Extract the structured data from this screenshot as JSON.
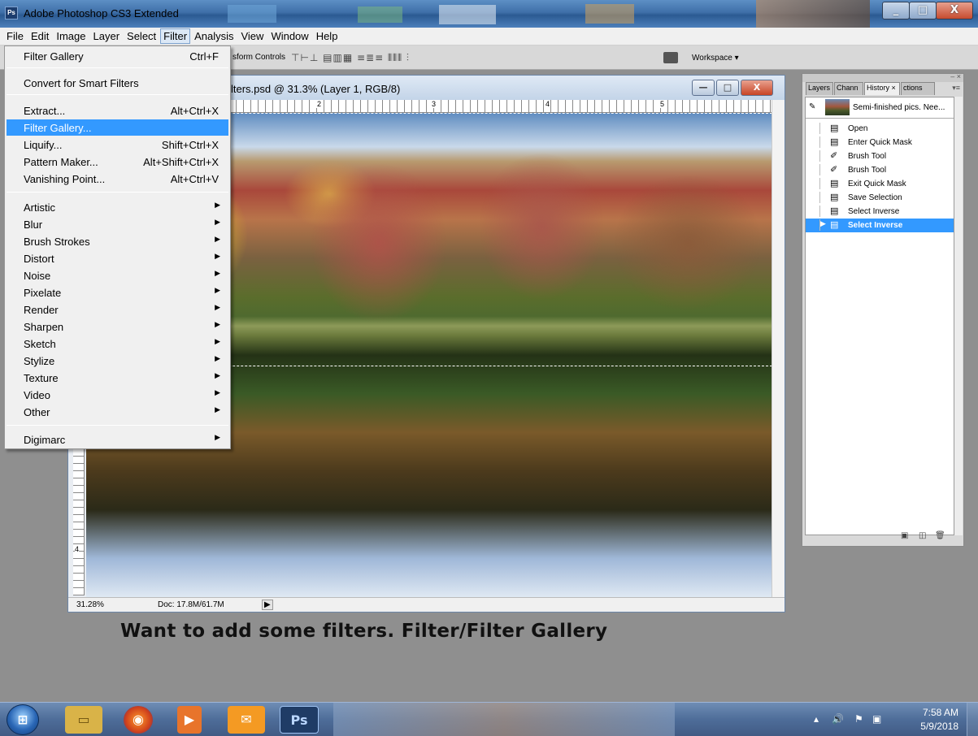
{
  "app": {
    "title": "Adobe Photoshop CS3 Extended",
    "logo": "Ps"
  },
  "menubar": {
    "items": [
      "File",
      "Edit",
      "Image",
      "Layer",
      "Select",
      "Filter",
      "Analysis",
      "View",
      "Window",
      "Help"
    ],
    "active": "Filter"
  },
  "options_bar": {
    "transform_controls": "sform Controls",
    "workspace": "Workspace ▾"
  },
  "document": {
    "title": "lters.psd @ 31.3% (Layer 1, RGB/8)",
    "ruler_h": [
      "2",
      "3",
      "4",
      "5"
    ],
    "ruler_v": [
      "4"
    ],
    "zoom": "31.28%",
    "doc_size": "Doc: 17.8M/61.7M"
  },
  "filter_menu": {
    "items": [
      {
        "label": "Filter Gallery",
        "shortcut": "Ctrl+F"
      },
      {
        "label": "Convert for Smart Filters",
        "shortcut": ""
      },
      {
        "label": "Extract...",
        "shortcut": "Alt+Ctrl+X"
      },
      {
        "label": "Filter Gallery...",
        "shortcut": "",
        "highlighted": true
      },
      {
        "label": "Liquify...",
        "shortcut": "Shift+Ctrl+X"
      },
      {
        "label": "Pattern Maker...",
        "shortcut": "Alt+Shift+Ctrl+X"
      },
      {
        "label": "Vanishing Point...",
        "shortcut": "Alt+Ctrl+V"
      },
      {
        "label": "Artistic",
        "submenu": true
      },
      {
        "label": "Blur",
        "submenu": true
      },
      {
        "label": "Brush Strokes",
        "submenu": true
      },
      {
        "label": "Distort",
        "submenu": true
      },
      {
        "label": "Noise",
        "submenu": true
      },
      {
        "label": "Pixelate",
        "submenu": true
      },
      {
        "label": "Render",
        "submenu": true
      },
      {
        "label": "Sharpen",
        "submenu": true
      },
      {
        "label": "Sketch",
        "submenu": true
      },
      {
        "label": "Stylize",
        "submenu": true
      },
      {
        "label": "Texture",
        "submenu": true
      },
      {
        "label": "Video",
        "submenu": true
      },
      {
        "label": "Other",
        "submenu": true
      },
      {
        "label": "Digimarc",
        "submenu": true
      }
    ]
  },
  "panel": {
    "tabs": [
      "Layers",
      "Chann",
      "History ×",
      "ctions"
    ],
    "active_tab": "History ×",
    "snapshot_label": "Semi-finished pics. Nee...",
    "history": [
      {
        "label": "Open",
        "icon": "document-icon"
      },
      {
        "label": "Enter Quick Mask",
        "icon": "document-icon"
      },
      {
        "label": "Brush Tool",
        "icon": "brush-icon"
      },
      {
        "label": "Brush Tool",
        "icon": "brush-icon"
      },
      {
        "label": "Exit Quick Mask",
        "icon": "document-icon"
      },
      {
        "label": "Save Selection",
        "icon": "document-icon"
      },
      {
        "label": "Select Inverse",
        "icon": "document-icon"
      },
      {
        "label": "Select Inverse",
        "icon": "document-icon",
        "selected": true
      }
    ]
  },
  "caption": "Want to add some filters.  Filter/Filter Gallery",
  "taskbar": {
    "apps": [
      "start",
      "explorer",
      "firefox",
      "media",
      "mail",
      "Ps"
    ],
    "clock_time": "7:58 AM",
    "clock_date": "5/9/2018"
  },
  "colors": {
    "highlight": "#3399ff",
    "menu_bg": "#f0f0f0",
    "workspace_bg": "#8f8f8f"
  }
}
